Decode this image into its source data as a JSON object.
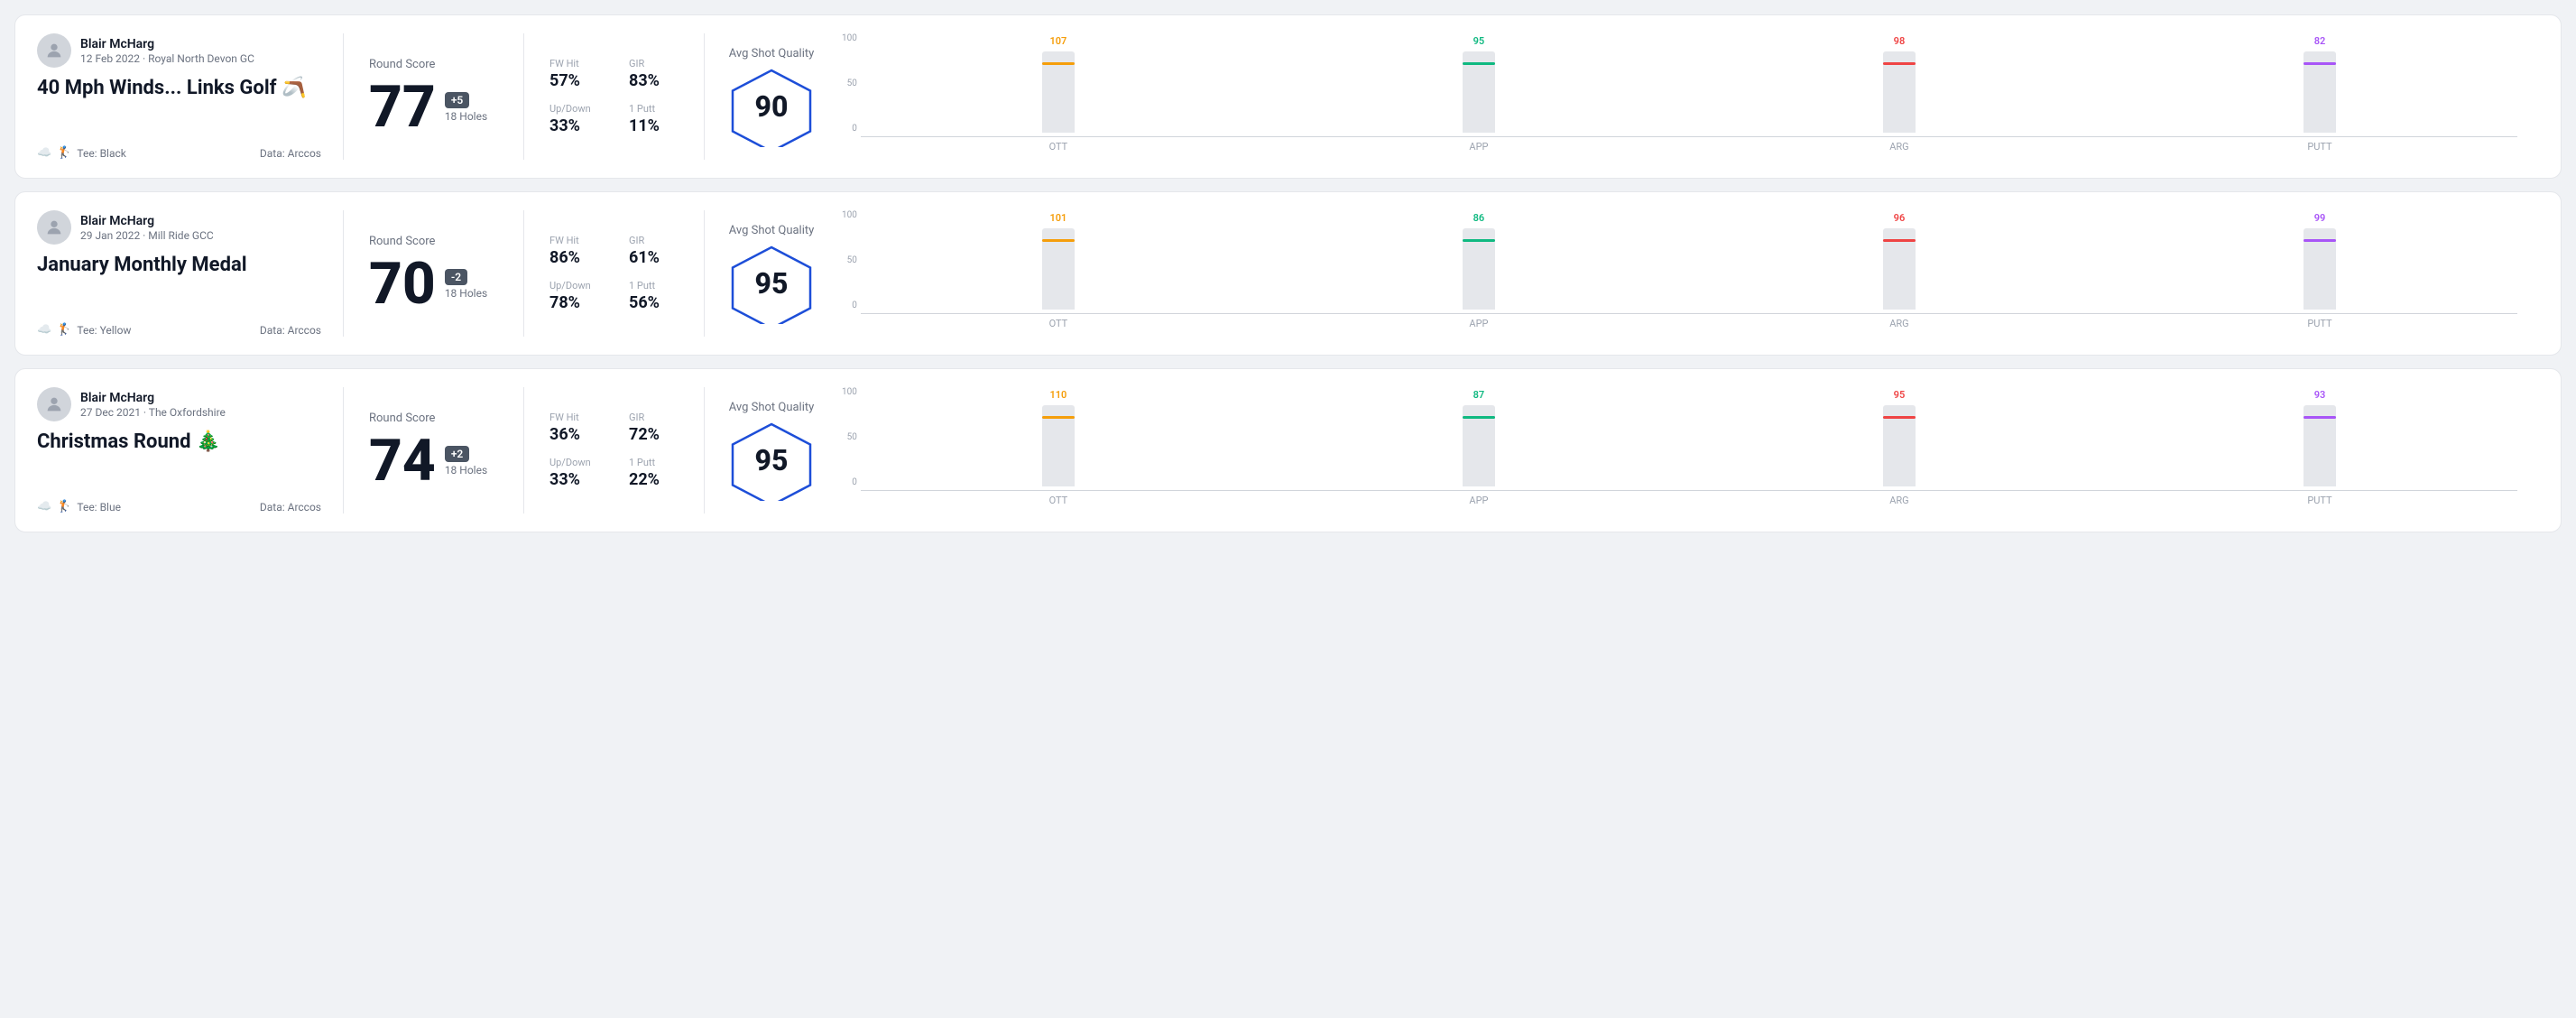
{
  "rounds": [
    {
      "id": "round-1",
      "user_name": "Blair McHarg",
      "user_date": "12 Feb 2022 · Royal North Devon GC",
      "title": "40 Mph Winds... Links Golf 🪃",
      "tee_label": "Tee: Black",
      "data_source": "Data: Arccos",
      "score": "77",
      "score_diff": "+5",
      "holes": "18 Holes",
      "score_label": "Round Score",
      "fw_hit_label": "FW Hit",
      "fw_hit_value": "57%",
      "gir_label": "GIR",
      "gir_value": "83%",
      "updown_label": "Up/Down",
      "updown_value": "33%",
      "one_putt_label": "1 Putt",
      "one_putt_value": "11%",
      "avg_quality_label": "Avg Shot Quality",
      "quality_score": "90",
      "chart": {
        "y_labels": [
          "100",
          "50",
          "0"
        ],
        "bars": [
          {
            "label": "OTT",
            "value": 107,
            "color": "#f59e0b",
            "max": 120
          },
          {
            "label": "APP",
            "value": 95,
            "color": "#10b981",
            "max": 120
          },
          {
            "label": "ARG",
            "value": 98,
            "color": "#ef4444",
            "max": 120
          },
          {
            "label": "PUTT",
            "value": 82,
            "color": "#a855f7",
            "max": 120
          }
        ]
      }
    },
    {
      "id": "round-2",
      "user_name": "Blair McHarg",
      "user_date": "29 Jan 2022 · Mill Ride GCC",
      "title": "January Monthly Medal",
      "tee_label": "Tee: Yellow",
      "data_source": "Data: Arccos",
      "score": "70",
      "score_diff": "-2",
      "holes": "18 Holes",
      "score_label": "Round Score",
      "fw_hit_label": "FW Hit",
      "fw_hit_value": "86%",
      "gir_label": "GIR",
      "gir_value": "61%",
      "updown_label": "Up/Down",
      "updown_value": "78%",
      "one_putt_label": "1 Putt",
      "one_putt_value": "56%",
      "avg_quality_label": "Avg Shot Quality",
      "quality_score": "95",
      "chart": {
        "y_labels": [
          "100",
          "50",
          "0"
        ],
        "bars": [
          {
            "label": "OTT",
            "value": 101,
            "color": "#f59e0b",
            "max": 120
          },
          {
            "label": "APP",
            "value": 86,
            "color": "#10b981",
            "max": 120
          },
          {
            "label": "ARG",
            "value": 96,
            "color": "#ef4444",
            "max": 120
          },
          {
            "label": "PUTT",
            "value": 99,
            "color": "#a855f7",
            "max": 120
          }
        ]
      }
    },
    {
      "id": "round-3",
      "user_name": "Blair McHarg",
      "user_date": "27 Dec 2021 · The Oxfordshire",
      "title": "Christmas Round 🎄",
      "tee_label": "Tee: Blue",
      "data_source": "Data: Arccos",
      "score": "74",
      "score_diff": "+2",
      "holes": "18 Holes",
      "score_label": "Round Score",
      "fw_hit_label": "FW Hit",
      "fw_hit_value": "36%",
      "gir_label": "GIR",
      "gir_value": "72%",
      "updown_label": "Up/Down",
      "updown_value": "33%",
      "one_putt_label": "1 Putt",
      "one_putt_value": "22%",
      "avg_quality_label": "Avg Shot Quality",
      "quality_score": "95",
      "chart": {
        "y_labels": [
          "100",
          "50",
          "0"
        ],
        "bars": [
          {
            "label": "OTT",
            "value": 110,
            "color": "#f59e0b",
            "max": 120
          },
          {
            "label": "APP",
            "value": 87,
            "color": "#10b981",
            "max": 120
          },
          {
            "label": "ARG",
            "value": 95,
            "color": "#ef4444",
            "max": 120
          },
          {
            "label": "PUTT",
            "value": 93,
            "color": "#a855f7",
            "max": 120
          }
        ]
      }
    }
  ]
}
